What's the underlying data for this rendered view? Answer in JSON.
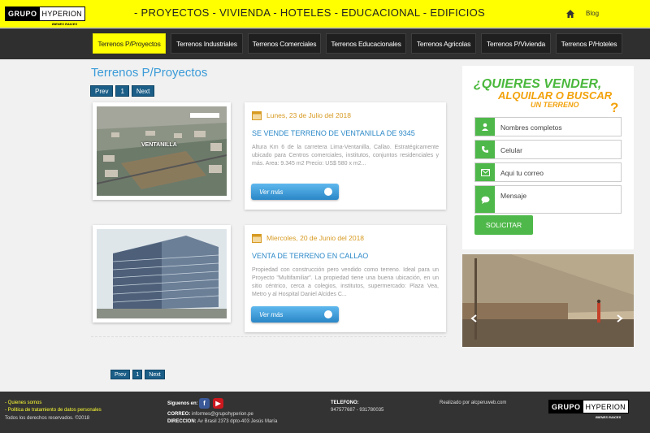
{
  "header": {
    "logo_main": "GRUPO",
    "logo_brand": "HYPERION",
    "logo_sub": "BIENES RAICES",
    "marquee": "- PROYECTOS - VIVIENDA - HOTELES - EDUCACIONAL - EDIFICIOS",
    "blog": "Blog"
  },
  "categories": [
    {
      "label": "Terrenos P/Proyectos",
      "active": true
    },
    {
      "label": "Terrenos Industriales",
      "active": false
    },
    {
      "label": "Terrenos Comerciales",
      "active": false
    },
    {
      "label": "Terrenos Educacionales",
      "active": false
    },
    {
      "label": "Terrenos Agricolas",
      "active": false
    },
    {
      "label": "Terrenos P/Vivienda",
      "active": false
    },
    {
      "label": "Terrenos P/Hoteles",
      "active": false
    }
  ],
  "section_title": "Terrenos P/Proyectos",
  "pagination": {
    "prev": "Prev",
    "page": "1",
    "next": "Next"
  },
  "listings": [
    {
      "date": "Lunes, 23 de Julio del 2018",
      "title": "SE VENDE TERRENO DE VENTANILLA DE 9345",
      "desc": "Altura Km 6 de la carretera Lima-Ventanilla, Callao. Estratégicamente ubicado para Centros comerciales, institutos, conjuntos residenciales y más. Area: 9.345 m2 Precio: US$ 580 x m2...",
      "image_label": "VENTANILLA",
      "button": "Ver más"
    },
    {
      "date": "Miercoles, 20 de Junio del 2018",
      "title": "VENTA DE TERRENO EN CALLAO",
      "desc": "Propiedad con construcción pero vendido como terreno. Ideal para un Proyecto \"Multifamiliar\". La propiedad tiene una buena ubicación, en un sitio céntrico, cerca a colegios, institutos, supermercado: Plaza Vea, Metro y al Hospital Daniel Alcides C...",
      "button": "Ver más"
    }
  ],
  "contact_form": {
    "headline_1": "¿QUIERES VENDER,",
    "headline_2": "ALQUILAR O BUSCAR",
    "headline_3": "UN TERRENO",
    "headline_q": "?",
    "name_placeholder": "Nombres completos",
    "phone_placeholder": "Celular",
    "email_placeholder": "Aqui tu correo",
    "message_placeholder": "Mensaje",
    "submit": "SOLICITAR"
  },
  "footer": {
    "link_about": "- Quienes somos",
    "link_policy": "- Politica de tratamiento de datos personales",
    "rights": "Todos los derechos reservados. ©2018",
    "follow": "Siguenos en:",
    "email_label": "CORREO:",
    "email": "informes@grupohyperion.pe",
    "address_label": "DIRECCION:",
    "address": "Av Brasil 2373 dpto-403 Jesús María",
    "phone_label": "TELEFONO:",
    "phones": "947577687 - 931780035",
    "made_by": "Realizado por alcperuweb.com"
  },
  "colors": {
    "brand_yellow": "#ffff00",
    "accent_blue": "#3b9bd8",
    "accent_green": "#4fb84a",
    "date_orange": "#d79a22"
  }
}
